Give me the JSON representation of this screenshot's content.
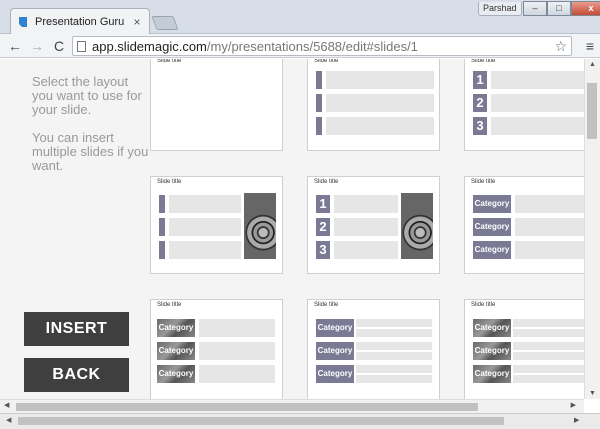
{
  "browser": {
    "tab_title": "Presentation Guru",
    "tab_close": "×",
    "profile": "Parshad",
    "url_host": "app.slidemagic.com",
    "url_path": "/my/presentations/5688/edit#slides/1",
    "win_minimize": "–",
    "win_maximize": "□",
    "win_close": "x",
    "back_icon": "←",
    "forward_icon": "→",
    "reload_icon": "C",
    "star_icon": "☆",
    "menu_icon": "≡"
  },
  "sidebar": {
    "instruction_1": "Select the layout you want to use for your slide.",
    "instruction_2": "You can insert multiple slides if you want.",
    "insert_label": "INSERT",
    "back_label": "BACK"
  },
  "layouts": {
    "slide_title": "Slide title",
    "numbers": [
      "1",
      "2",
      "3"
    ],
    "category": "Category"
  },
  "colors": {
    "accent": "#7a7a94",
    "button_bg": "#3f3f3f"
  },
  "scrollbars": {
    "up": "▲",
    "down": "▼",
    "left": "◀",
    "right": "▶"
  }
}
